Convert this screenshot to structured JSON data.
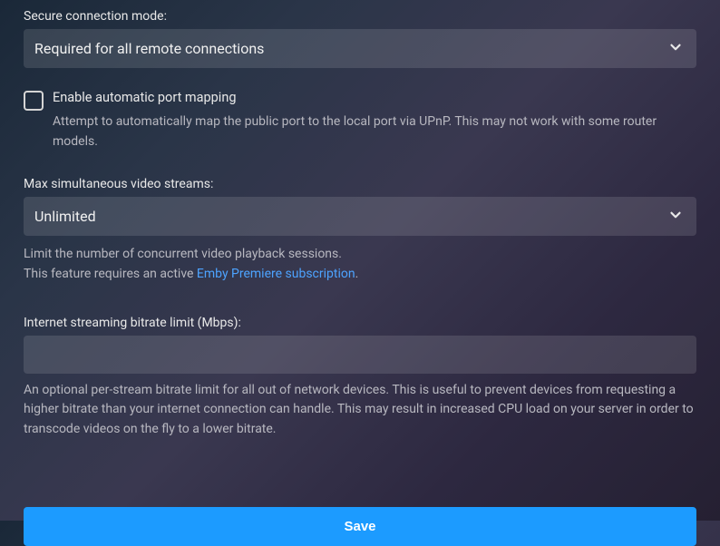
{
  "secureConnection": {
    "label": "Secure connection mode:",
    "value": "Required for all remote connections"
  },
  "portMapping": {
    "label": "Enable automatic port mapping",
    "help": "Attempt to automatically map the public port to the local port via UPnP. This may not work with some router models."
  },
  "maxStreams": {
    "label": "Max simultaneous video streams:",
    "value": "Unlimited",
    "help1": "Limit the number of concurrent video playback sessions.",
    "help2_prefix": "This feature requires an active ",
    "help2_link": "Emby Premiere subscription",
    "help2_suffix": "."
  },
  "bitrateLimit": {
    "label": "Internet streaming bitrate limit (Mbps):",
    "value": "",
    "help": "An optional per-stream bitrate limit for all out of network devices. This is useful to prevent devices from requesting a higher bitrate than your internet connection can handle. This may result in increased CPU load on your server in order to transcode videos on the fly to a lower bitrate."
  },
  "saveButton": "Save"
}
